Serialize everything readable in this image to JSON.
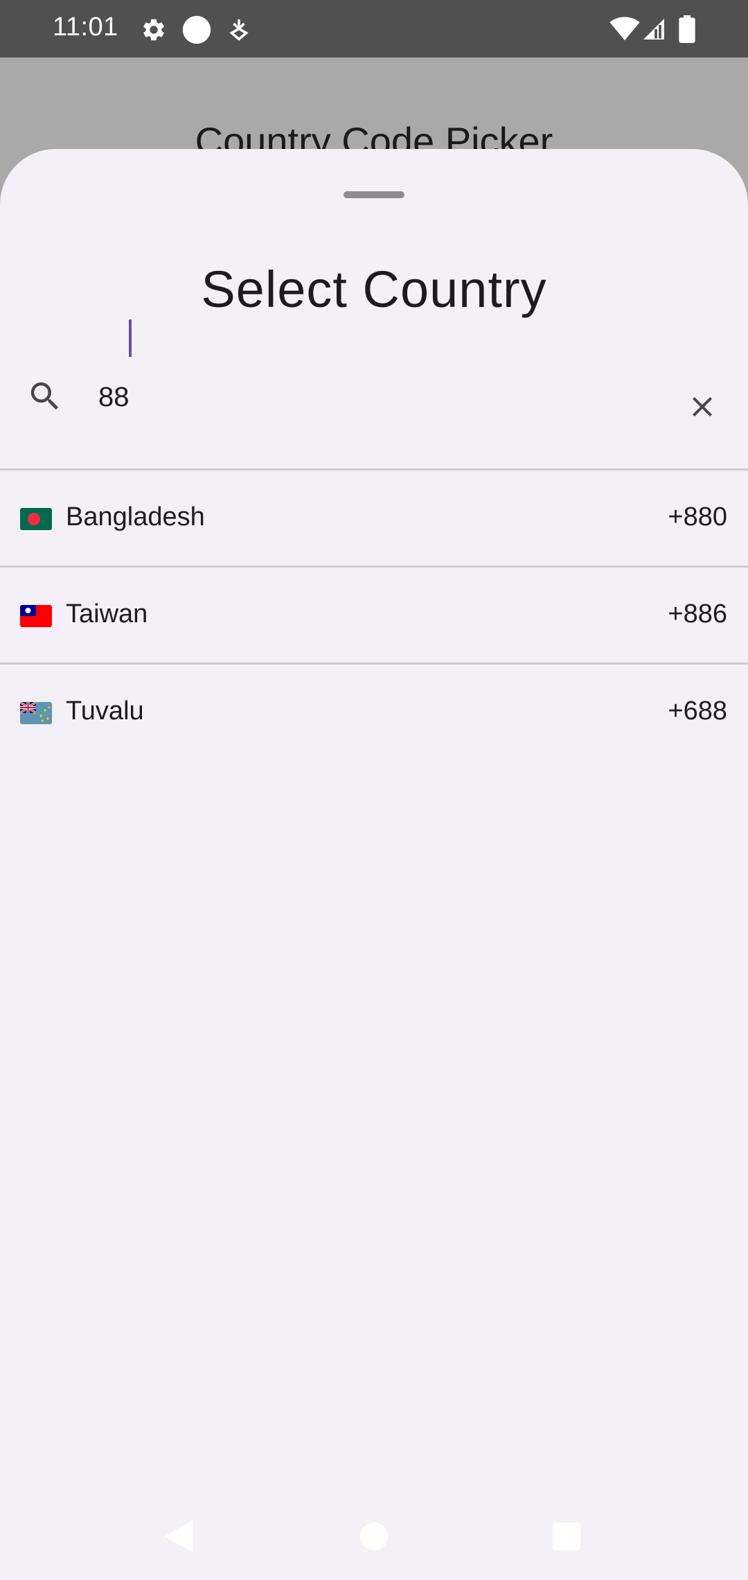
{
  "status_bar": {
    "time": "11:01",
    "icons": [
      "gear-icon",
      "circle-icon",
      "download-icon",
      "wifi-icon",
      "signal-icon",
      "battery-icon"
    ]
  },
  "background_app": {
    "title": "Country Code Picker"
  },
  "sheet": {
    "title": "Select Country",
    "search": {
      "value": "88",
      "search_icon": "search-icon",
      "clear_icon": "close-icon"
    },
    "countries": [
      {
        "name": "Bangladesh",
        "code": "+880",
        "flag": "flag-bangladesh"
      },
      {
        "name": "Taiwan",
        "code": "+886",
        "flag": "flag-taiwan"
      },
      {
        "name": "Tuvalu",
        "code": "+688",
        "flag": "flag-tuvalu"
      }
    ]
  },
  "nav_bar": {
    "buttons": [
      "back-icon",
      "home-icon",
      "recents-icon"
    ]
  },
  "colors": {
    "sheet_background": "#f4f0f7",
    "scrim": "#a9a9a9",
    "status_bar": "#505050",
    "accent": "#6750a4",
    "text": "#1d1b20",
    "divider": "#cfcbd3"
  }
}
